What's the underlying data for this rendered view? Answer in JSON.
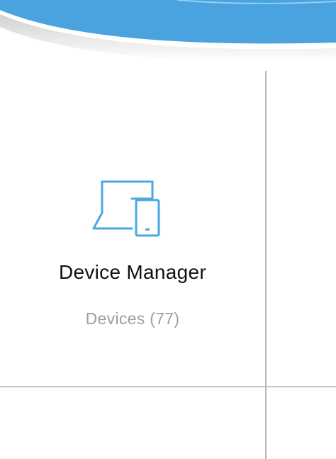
{
  "colors": {
    "banner_blue": "#4aa3df",
    "icon_blue": "#4aa8e0",
    "divider_gray": "#b8b8b8",
    "title_text": "#111111",
    "subtitle_text": "#9e9e9e"
  },
  "tile": {
    "icon": "laptop-phone-icon",
    "title": "Device Manager",
    "subtitle": "Devices (77)"
  }
}
